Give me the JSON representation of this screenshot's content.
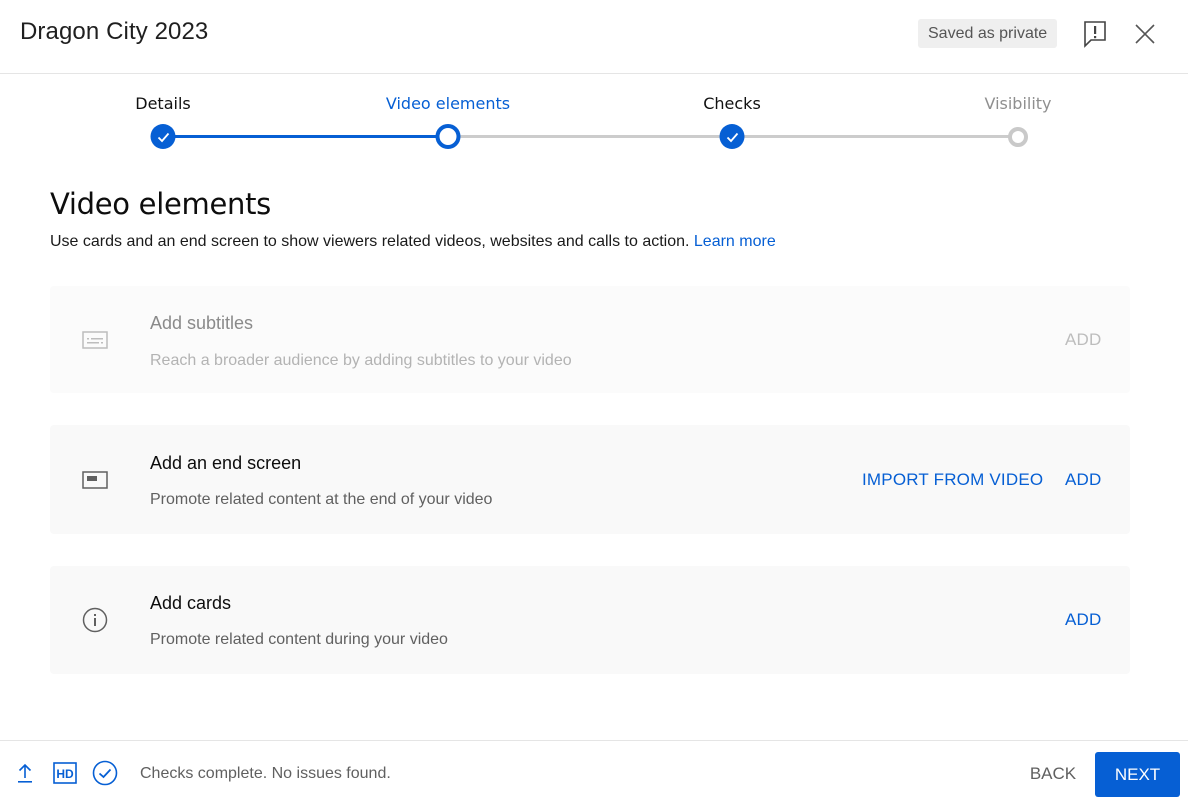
{
  "header": {
    "title": "Dragon City 2023",
    "saved_badge": "Saved as private",
    "feedback_icon": "feedback-icon",
    "close_icon": "close-icon"
  },
  "stepper": {
    "steps": [
      {
        "label": "Details",
        "state": "done"
      },
      {
        "label": "Video elements",
        "state": "active"
      },
      {
        "label": "Checks",
        "state": "done"
      },
      {
        "label": "Visibility",
        "state": "pending"
      }
    ]
  },
  "main": {
    "title": "Video elements",
    "description": "Use cards and an end screen to show viewers related videos, websites and calls to action.",
    "learn_more": "Learn more",
    "cards": [
      {
        "icon": "subtitles-icon",
        "title": "Add subtitles",
        "description": "Reach a broader audience by adding subtitles to your video",
        "actions": [
          "ADD"
        ],
        "disabled": true
      },
      {
        "icon": "end-screen-icon",
        "title": "Add an end screen",
        "description": "Promote related content at the end of your video",
        "actions": [
          "IMPORT FROM VIDEO",
          "ADD"
        ],
        "disabled": false
      },
      {
        "icon": "info-icon",
        "title": "Add cards",
        "description": "Promote related content during your video",
        "actions": [
          "ADD"
        ],
        "disabled": false
      }
    ]
  },
  "footer": {
    "icons": [
      "upload-icon",
      "hd-icon",
      "check-circle-icon"
    ],
    "hd_label": "HD",
    "status": "Checks complete. No issues found.",
    "back_label": "BACK",
    "next_label": "NEXT"
  },
  "colors": {
    "accent": "#065fd4",
    "card_bg": "#f9f9f9",
    "track_pending": "#cccccc"
  }
}
